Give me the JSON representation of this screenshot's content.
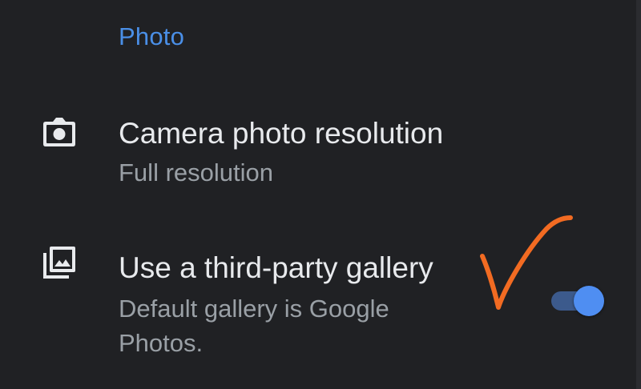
{
  "section": {
    "title": "Photo"
  },
  "settings": [
    {
      "icon": "camera-icon",
      "title": "Camera photo resolution",
      "summary": "Full resolution"
    },
    {
      "icon": "photo-library-icon",
      "title": "Use a third-party gallery",
      "summary": "Default gallery is Google Photos.",
      "toggle": "on"
    }
  ],
  "colors": {
    "background": "#202124",
    "accent": "#4a8fe7",
    "title_text": "#e8eaed",
    "summary_text": "#9aa0a6",
    "toggle_thumb": "#4f8ef2",
    "toggle_track": "#3c5a8c",
    "annotation_checkmark": "#f26b22"
  },
  "annotation": {
    "icon": "orange-checkmark-annotation"
  }
}
